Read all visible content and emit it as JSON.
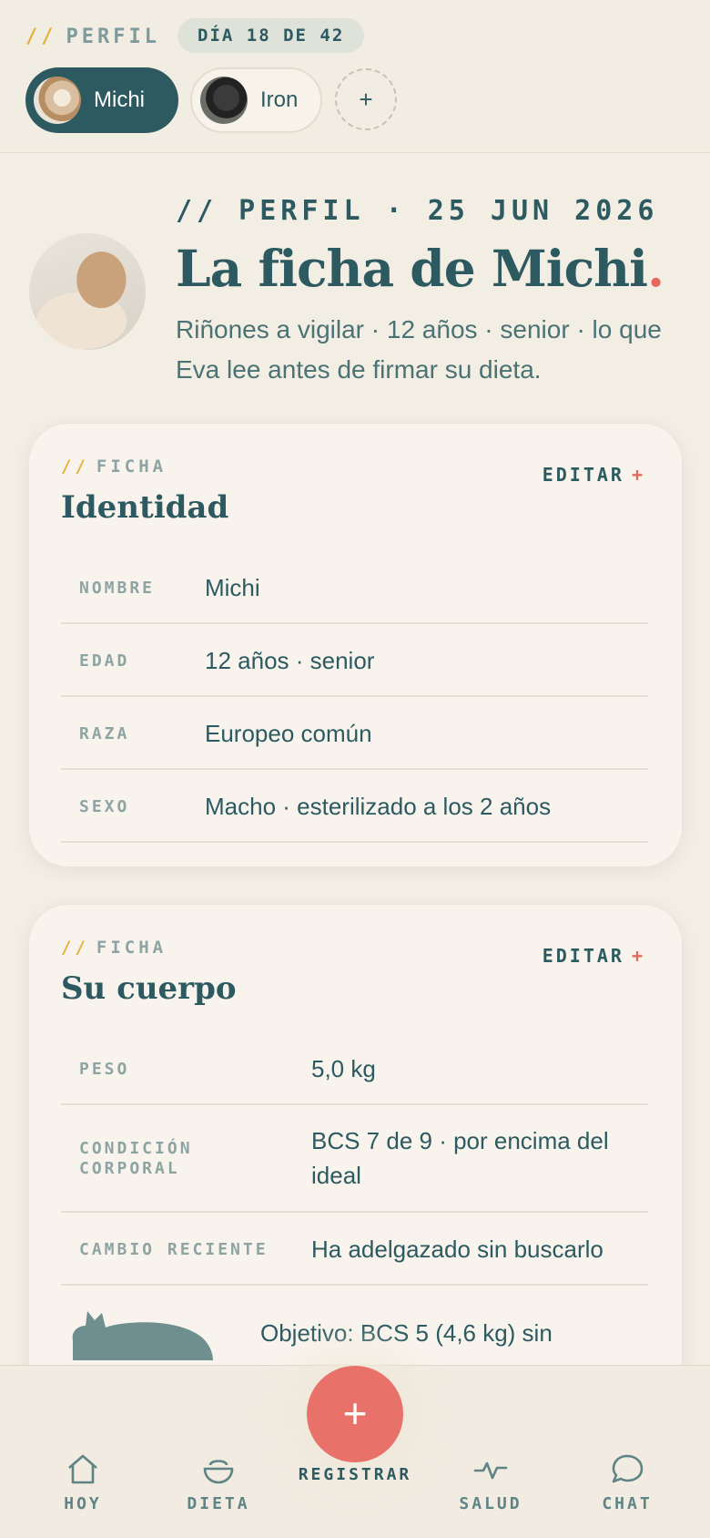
{
  "topbar": {
    "crumb_slash": "//",
    "crumb": "PERFIL",
    "day": "DÍA 18 DE 42",
    "pets": [
      {
        "name": "Michi",
        "active": true
      },
      {
        "name": "Iron",
        "active": false
      }
    ],
    "add": "+"
  },
  "header": {
    "crumb": "// PERFIL · 25 JUN 2026",
    "title": "La ficha de Michi",
    "title_dot": ".",
    "subtitle": "Riñones a vigilar · 12 años · senior · lo que Eva lee antes de firmar su dieta."
  },
  "cards": [
    {
      "kicker_slash": "//",
      "kicker": "FICHA",
      "title": "Identidad",
      "edit": "EDITAR",
      "edit_plus": "+",
      "rows": [
        {
          "k": "NOMBRE",
          "v": "Michi"
        },
        {
          "k": "EDAD",
          "v": "12 años · senior"
        },
        {
          "k": "RAZA",
          "v": "Europeo común"
        },
        {
          "k": "SEXO",
          "v": "Macho · esterilizado a los 2 años"
        }
      ]
    },
    {
      "kicker_slash": "//",
      "kicker": "FICHA",
      "title": "Su cuerpo",
      "edit": "EDITAR",
      "edit_plus": "+",
      "rows": [
        {
          "k": "PESO",
          "v": "5,0 kg"
        },
        {
          "k": "CONDICIÓN CORPORAL",
          "v": "BCS 7 de 9 · por encima del ideal"
        },
        {
          "k": "CAMBIO RECIENTE",
          "v": "Ha adelgazado sin buscarlo"
        }
      ],
      "goal": "Objetivo: BCS 5 (4,6 kg) sin"
    }
  ],
  "nav": {
    "hoy": "HOY",
    "dieta": "DIETA",
    "registrar": "REGISTRAR",
    "fab": "+",
    "salud": "SALUD",
    "chat": "CHAT"
  },
  "colors": {
    "primary": "#2c5a60",
    "accent": "#e6685c",
    "highlight": "#e3b23c",
    "background": "#f3eee4"
  },
  "icons": [
    "home-icon",
    "bowl-icon",
    "plus-icon",
    "pulse-icon",
    "chat-bubble-icon",
    "cat-silhouette-icon"
  ]
}
